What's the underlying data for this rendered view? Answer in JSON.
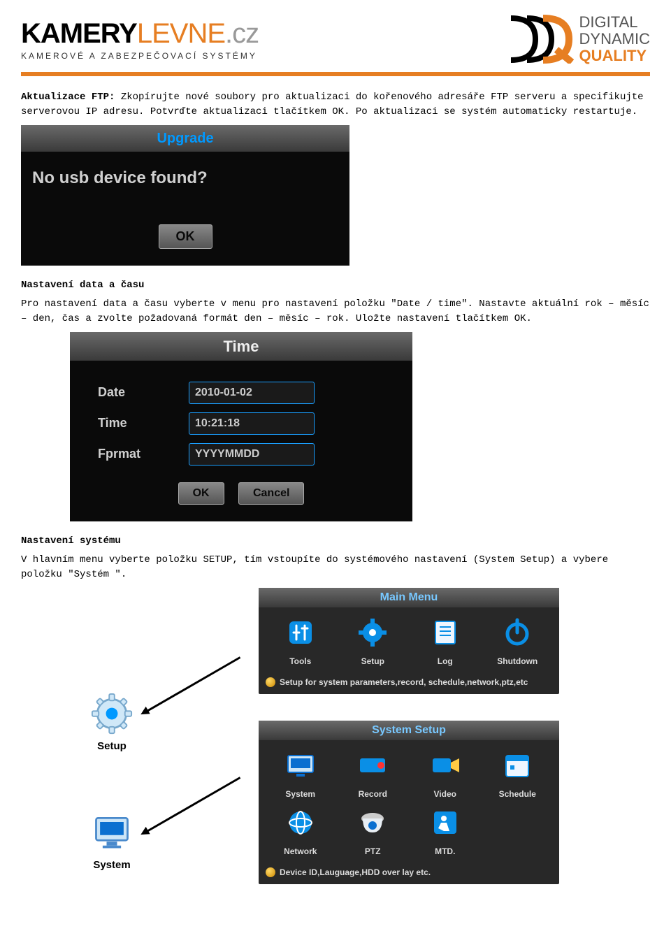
{
  "header": {
    "logo_black": "KAMERY",
    "logo_orange": "LEVNE",
    "logo_cz": ".cz",
    "logo_sub": "KAMEROVÉ A ZABEZPEČOVACÍ SYSTÉMY",
    "ddq_line1": "DIGITAL",
    "ddq_line2": "DYNAMIC",
    "ddq_line3": "QUALITY"
  },
  "section_ftp": {
    "title": "Aktualizace FTP:",
    "body": "Zkopírujte nové soubory pro aktualizaci do kořenového adresáře FTP serveru a specifikujte serverovou IP adresu. Potvrďte aktualizaci tlačítkem OK. Po aktualizaci se systém automaticky restartuje."
  },
  "upgrade_dialog": {
    "title": "Upgrade",
    "message": "No usb device found?",
    "ok": "OK"
  },
  "section_time": {
    "title": "Nastavení data a času",
    "body": "Pro nastavení data a času vyberte v menu pro nastavení položku \"Date / time\". Nastavte aktuální rok – měsíc – den, čas a zvolte požadovaná formát den – měsíc – rok. Uložte nastavení tlačítkem OK."
  },
  "time_dialog": {
    "title": "Time",
    "date_label": "Date",
    "date_value": "2010-01-02",
    "time_label": "Time",
    "time_value": "10:21:18",
    "format_label": "Fprmat",
    "format_value": "YYYYMMDD",
    "ok": "OK",
    "cancel": "Cancel"
  },
  "section_system": {
    "title": "Nastavení systému",
    "body": "V hlavním menu vyberte položku SETUP, tím vstoupíte do systémového nastavení (System Setup) a vybere položku \"Systém \"."
  },
  "external_icons": {
    "setup_label": "Setup",
    "system_label": "System"
  },
  "main_menu": {
    "title": "Main Menu",
    "items": [
      "Tools",
      "Setup",
      "Log",
      "Shutdown"
    ],
    "footer": "Setup for system parameters,record, schedule,network,ptz,etc"
  },
  "system_setup": {
    "title": "System Setup",
    "row1": [
      "System",
      "Record",
      "Video",
      "Schedule"
    ],
    "row2": [
      "Network",
      "PTZ",
      "MTD."
    ],
    "footer": "Device ID,Lauguage,HDD over lay etc."
  }
}
